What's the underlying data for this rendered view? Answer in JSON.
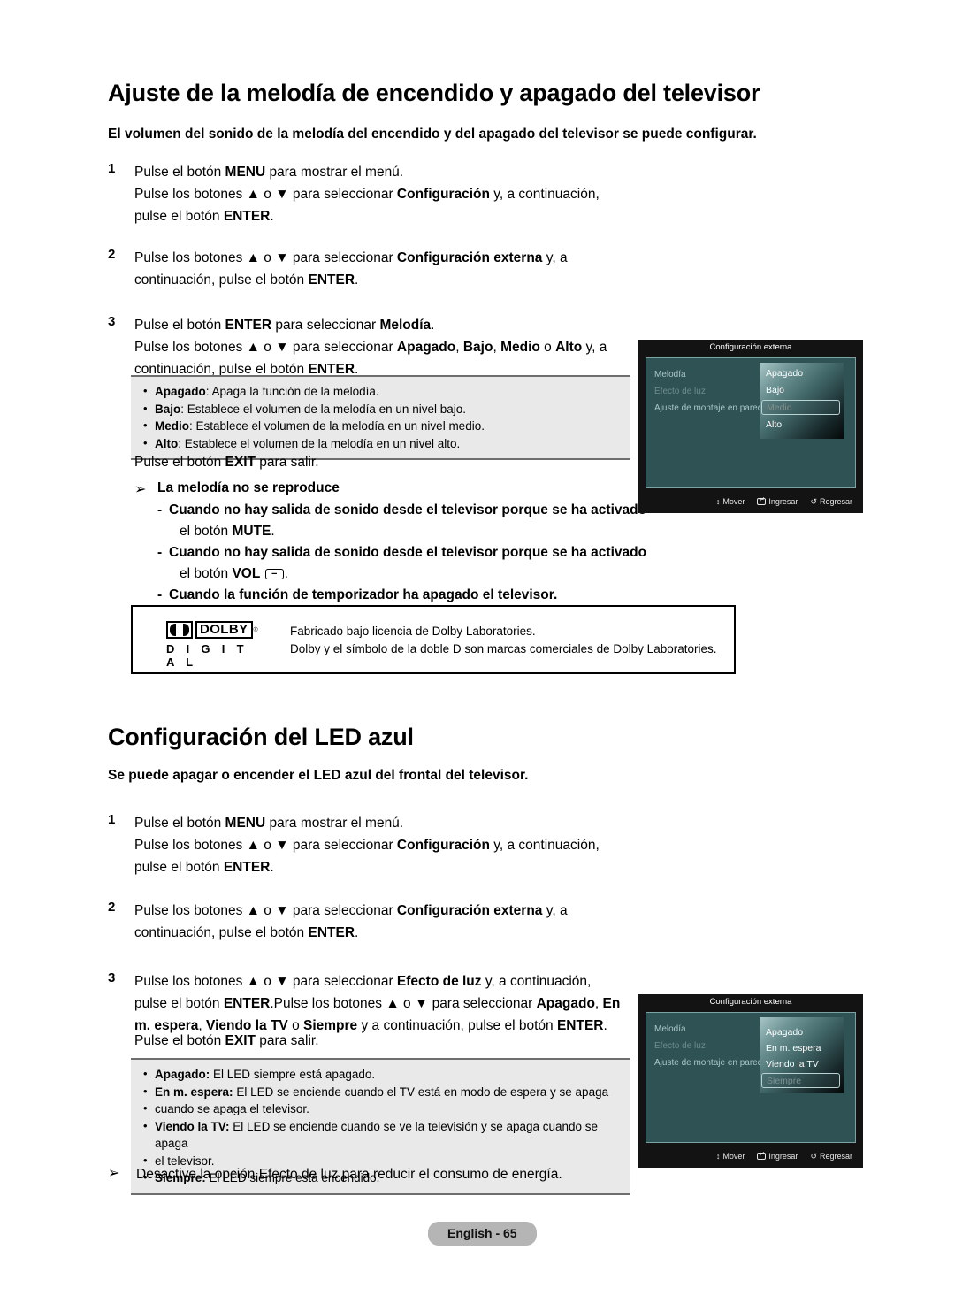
{
  "document": {
    "language_footer": "English - 65"
  },
  "section1": {
    "heading": "Ajuste de la melodía de encendido y apagado del televisor",
    "lead": "El volumen del sonido de la melodía del encendido y del apagado del televisor se puede configurar.",
    "steps": [
      {
        "number": "1",
        "lines": [
          "Pulse el botón MENU para mostrar el menú.",
          "Pulse los botones ▲ o ▼ para seleccionar Configuración y, a continuación,",
          "pulse el botón ENTER."
        ]
      },
      {
        "number": "2",
        "lines": [
          "Pulse los botones ▲ o ▼ para seleccionar Configuración externa y, a",
          "continuación, pulse el botón ENTER."
        ]
      },
      {
        "number": "3",
        "lines": [
          "Pulse el botón ENTER para seleccionar Melodía.",
          "Pulse los botones ▲ o ▼ para seleccionar Apagado, Bajo, Medio o Alto y, a",
          "continuación, pulse el botón ENTER."
        ]
      }
    ],
    "notebox": [
      {
        "term": "Apagado",
        "sep": ": ",
        "text": "Apaga la función de la melodía."
      },
      {
        "term": "Bajo",
        "sep": ": ",
        "text": "Establece el volumen de la melodía en un nivel bajo."
      },
      {
        "term": "Medio",
        "sep": ": ",
        "text": "Establece el volumen de la melodía en un nivel medio."
      },
      {
        "term": "Alto",
        "sep": ": ",
        "text": "Establece el volumen de la melodía en un nivel alto."
      }
    ],
    "exit_line": "Pulse el botón EXIT para salir.",
    "arrow_block": {
      "arrow_glyph": "➢",
      "title": "La melodía no se reproduce",
      "items": [
        "Cuando no hay salida de sonido desde el televisor porque se ha activado",
        "el botón MUTE.",
        "Cuando no hay salida de sonido desde el televisor porque se ha activado",
        "el botón VOL",
        "Cuando la función de temporizador ha apagado el televisor."
      ],
      "vol_key_label": "−"
    }
  },
  "dolby": {
    "mark_word": "DOLBY",
    "registered": "®",
    "subword": "D I G I T A L",
    "lines": [
      "Fabricado bajo licencia de Dolby Laboratories.",
      "Dolby y el símbolo de la doble D son marcas comerciales de Dolby Laboratories."
    ]
  },
  "section2": {
    "heading": "Configuración del LED azul",
    "lead": "Se puede apagar o encender el LED azul del frontal del televisor.",
    "steps": [
      {
        "number": "1",
        "lines": [
          "Pulse el botón MENU para mostrar el menú.",
          "Pulse los botones ▲ o ▼ para seleccionar Configuración y, a continuación,",
          "pulse el botón ENTER."
        ]
      },
      {
        "number": "2",
        "lines": [
          "Pulse los botones ▲ o ▼ para seleccionar Configuración externa y, a",
          "continuación, pulse el botón ENTER."
        ]
      },
      {
        "number": "3",
        "lines": [
          "Pulse los botones ▲ o ▼ para seleccionar Efecto de luz y, a continuación,",
          "pulse el botón ENTER.Pulse los botones ▲ o ▼ para seleccionar Apagado, En",
          "m. espera, Viendo la TV o Siempre y a continuación, pulse el botón ENTER."
        ]
      }
    ],
    "exit_line": "Pulse el botón EXIT para salir.",
    "notebox": [
      {
        "term": "Apagado:",
        "sep": " ",
        "text": "El LED siempre está apagado."
      },
      {
        "term": "En m. espera:",
        "sep": " ",
        "text": "El LED se enciende cuando el TV está en modo de espera y se apaga"
      },
      {
        "term": "",
        "sep": "",
        "text": "cuando se apaga el televisor.",
        "cont": true
      },
      {
        "term": "Viendo la TV:",
        "sep": " ",
        "text": "El LED se enciende cuando se ve la televisión y se apaga cuando se apaga"
      },
      {
        "term": "",
        "sep": "",
        "text": "el televisor.",
        "cont": true
      },
      {
        "term": "Siempre:",
        "sep": " ",
        "text": "El LED siempre está encendido."
      }
    ],
    "tip": {
      "arrow_glyph": "➢",
      "text": "Desactive la opción Efecto de luz para reducir el consumo de energía."
    }
  },
  "osd_melody": {
    "title": "Configuración externa",
    "menu_items": [
      "Melodía",
      "Efecto de luz",
      "Ajuste de montaje en pared"
    ],
    "dimmed_index": 1,
    "colon": ":",
    "options": [
      "Apagado",
      "Bajo",
      "Medio",
      "Alto"
    ],
    "selected": "Medio",
    "hints": [
      {
        "glyph": "↕",
        "label": "Mover"
      },
      {
        "glyph": "enter",
        "label": "Ingresar"
      },
      {
        "glyph": "↺",
        "label": "Regresar"
      }
    ]
  },
  "osd_led": {
    "title": "Configuración externa",
    "menu_items": [
      "Melodía",
      "Efecto de luz",
      "Ajuste de montaje en pared"
    ],
    "dimmed_index": 1,
    "colon": ":",
    "options": [
      "Apagado",
      "En m. espera",
      "Viendo la TV",
      "Siempre"
    ],
    "selected": "Siempre",
    "hints": [
      {
        "glyph": "↕",
        "label": "Mover"
      },
      {
        "glyph": "enter",
        "label": "Ingresar"
      },
      {
        "glyph": "↺",
        "label": "Regresar"
      }
    ]
  }
}
